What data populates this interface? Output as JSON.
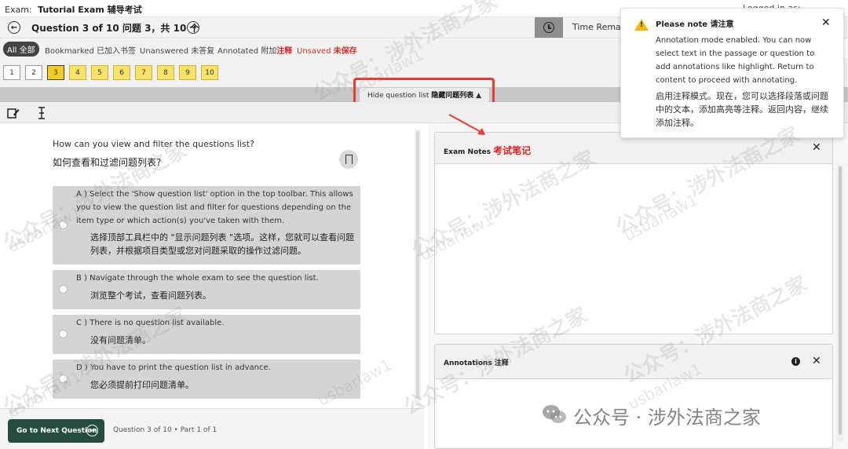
{
  "topbar": {
    "exam_prefix": "Exam:",
    "exam_name": "Tutorial Exam 辅导考试",
    "logged_in": "Logged in as:"
  },
  "header": {
    "title": "Question 3 of 10 问题 3，共 10 个",
    "prev_icon": "arrow-left-icon",
    "next_icon": "arrow-right-icon",
    "time_label": "Time Remain"
  },
  "filters": {
    "all": "All 全部",
    "bookmarked": "Bookmarked 已加入书签",
    "unanswered": "Unanswered 未答复",
    "annotated_prefix": "Annotated 附加",
    "annotated_red": "注释",
    "unsaved_en": "Unsaved",
    "unsaved_zh": "未保存"
  },
  "question_numbers": [
    {
      "label": "1",
      "state": "normal"
    },
    {
      "label": "2",
      "state": "normal"
    },
    {
      "label": "3",
      "state": "current"
    },
    {
      "label": "4",
      "state": "yellow"
    },
    {
      "label": "5",
      "state": "yellow"
    },
    {
      "label": "6",
      "state": "yellow"
    },
    {
      "label": "7",
      "state": "yellow"
    },
    {
      "label": "8",
      "state": "yellow"
    },
    {
      "label": "9",
      "state": "yellow"
    },
    {
      "label": "10",
      "state": "yellow"
    }
  ],
  "hide_list": {
    "en": "Hide question list",
    "zh": "隐藏问题列表"
  },
  "question": {
    "text_en": "How can you view and filter the questions list?",
    "text_zh": "如何查看和过滤问题列表?",
    "options": [
      {
        "letter": "A )",
        "en": "Select the 'Show question list' option in the top toolbar. This allows you to view the question list and filter for questions depending on the item type or which action(s) you've taken with them.",
        "zh": "选择顶部工具栏中的 \"显示问题列表 \"选项。这样，您就可以查看问题列表，并根据项目类型或您对问题采取的操作过滤问题。"
      },
      {
        "letter": "B )",
        "en": "Navigate through the whole exam to see the question list.",
        "zh": "浏览整个考试，查看问题列表。"
      },
      {
        "letter": "C )",
        "en": "There is no question list available.",
        "zh": "没有问题清单。"
      },
      {
        "letter": "D )",
        "en": "You have to print the question list in advance.",
        "zh": "您必须提前打印问题清单。"
      }
    ]
  },
  "bottom": {
    "next_label": "Go to Next Question",
    "info": "Question 3 of 10  •  Part 1 of 1"
  },
  "notes_panel": {
    "title_en": "Exam Notes",
    "title_zh": "考试笔记"
  },
  "annotations_panel": {
    "title": "Annotations 注释"
  },
  "popover": {
    "title": "Please note 请注意",
    "body_en": "Annotation mode enabled. You can now select text in the passage or question to add annotations like highlight. Return to content to proceed with annotating.",
    "body_zh": "启用注释模式。现在，您可以选择段落或问题中的文本，添加高亮等注释。返回内容，继续添加注释。"
  },
  "watermark": {
    "main": "公众号：涉外法商之家",
    "sub": "usbarlaw1",
    "wechat": "公众号 · 涉外法商之家"
  },
  "colors": {
    "current_question": "#f2cc1f",
    "answered_question": "#f7e36a",
    "next_button": "#244d40",
    "highlight_red": "#e02020",
    "warning": "#f5b800"
  }
}
